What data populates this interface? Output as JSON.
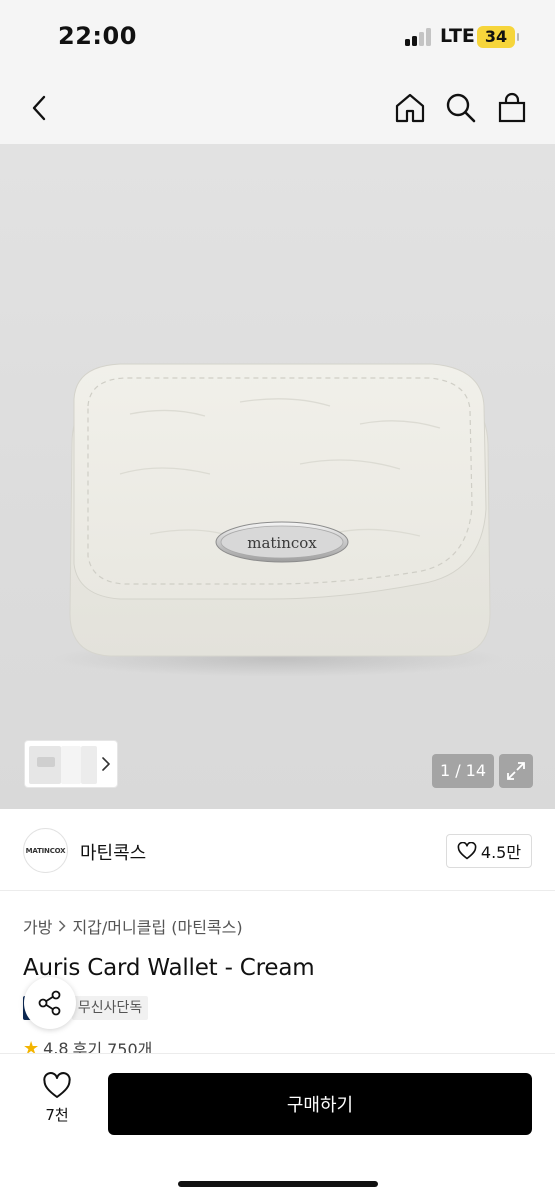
{
  "status_bar": {
    "time": "22:00",
    "network": "LTE",
    "battery": "34",
    "signal_bars_active": 2,
    "signal_bars_total": 4
  },
  "nav": {
    "back_icon": "chevron-left-icon",
    "home_icon": "home-icon",
    "search_icon": "search-icon",
    "cart_icon": "shopping-bag-icon"
  },
  "gallery": {
    "wallet_badge_text": "matincox",
    "page_counter": "1 / 14",
    "expand_icon": "expand-icon"
  },
  "brand": {
    "logo_text": "MATINCOX",
    "name": "마틴콕스",
    "likes": "4.5만"
  },
  "breadcrumb": {
    "category": "가방",
    "subcategory": "지갑/머니클립 (마틴콕스)"
  },
  "product": {
    "title": "Auris Card Wallet - Cream",
    "tags": {
      "first": "이",
      "second": "무신사단독"
    },
    "rating": "4.8",
    "reviews": "후기 750개"
  },
  "bottom_bar": {
    "wish_count": "7천",
    "buy_label": "구매하기"
  },
  "colors": {
    "buy_button": "#000000",
    "battery": "#f6d53b",
    "tag_dark": "#0d2a55",
    "rating_star": "#f3b400"
  }
}
